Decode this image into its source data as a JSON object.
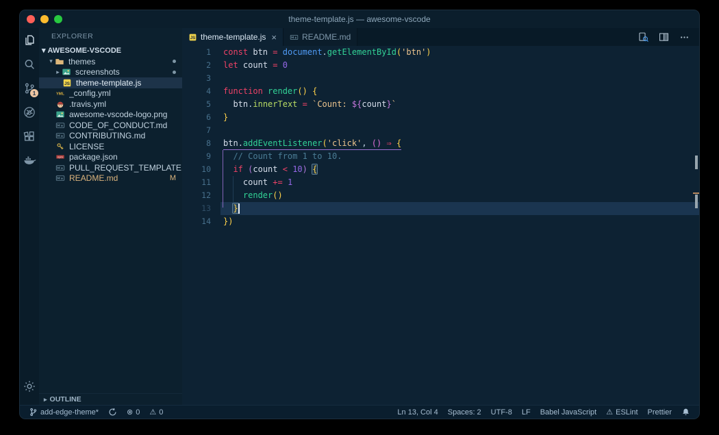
{
  "window": {
    "title": "theme-template.js — awesome-vscode",
    "traffic_lights": {
      "close": "#ff5f57",
      "minimize": "#febc2e",
      "zoom": "#28c840"
    }
  },
  "colors": {
    "pl": "#d6deeb",
    "kw": "#ee4266",
    "var": "#d6deeb",
    "fn": "#32d296",
    "blue": "#509bf5",
    "str": "#ecc48d",
    "num": "#9668e8",
    "cmt": "#4b7d96",
    "prop": "#b9dc64",
    "tpl": "#c678dd",
    "punct": "#c3d4e5",
    "p1": "#ffd24a",
    "p2": "#e06fd8",
    "p3": "#b57bdc",
    "p1m": "#ffd24a",
    "badge": "#edc5a2",
    "modified": "#dcb47d"
  },
  "activity_bar": {
    "items": [
      {
        "name": "explorer",
        "icon": "explorer",
        "active": true
      },
      {
        "name": "search",
        "icon": "search"
      },
      {
        "name": "source-control",
        "icon": "source-control",
        "badge": "1"
      },
      {
        "name": "debug-disabled",
        "icon": "bug-slash"
      },
      {
        "name": "extensions",
        "icon": "extensions"
      },
      {
        "name": "docker",
        "icon": "docker"
      }
    ],
    "bottom": [
      {
        "name": "settings",
        "icon": "gear"
      }
    ]
  },
  "sidebar": {
    "title": "EXPLORER",
    "section": "AWESOME-VSCODE",
    "outline": "OUTLINE",
    "files": [
      {
        "label": "themes",
        "icon": "folder",
        "caret": "down",
        "indent": 12,
        "dot": true
      },
      {
        "label": "screenshots",
        "icon": "image",
        "caret": "right",
        "indent": 22,
        "dot": true
      },
      {
        "label": "theme-template.js",
        "icon": "js",
        "indent": 34,
        "selected": true
      },
      {
        "label": "_config.yml",
        "icon": "yml",
        "indent": 24
      },
      {
        "label": ".travis.yml",
        "icon": "travis",
        "indent": 24
      },
      {
        "label": "awesome-vscode-logo.png",
        "icon": "image",
        "indent": 24
      },
      {
        "label": "CODE_OF_CONDUCT.md",
        "icon": "md",
        "indent": 24
      },
      {
        "label": "CONTRIBUTING.md",
        "icon": "md",
        "indent": 24
      },
      {
        "label": "LICENSE",
        "icon": "key",
        "indent": 24
      },
      {
        "label": "package.json",
        "icon": "npm",
        "indent": 24
      },
      {
        "label": "PULL_REQUEST_TEMPLATE.md",
        "icon": "md",
        "indent": 24
      },
      {
        "label": "README.md",
        "icon": "md",
        "indent": 24,
        "badge": "M",
        "modified": true
      }
    ]
  },
  "tabs": [
    {
      "name": "tab-theme-template",
      "label": "theme-template.js",
      "icon": "js",
      "active": true,
      "close": "×"
    },
    {
      "name": "tab-readme",
      "label": "README.md",
      "icon": "md"
    }
  ],
  "editor_actions": [
    {
      "name": "open-preview",
      "icon": "preview"
    },
    {
      "name": "split-editor",
      "icon": "split"
    },
    {
      "name": "more-actions",
      "icon": "ellipsis"
    }
  ],
  "editor": {
    "current_line": 13,
    "cursor": {
      "line": 13,
      "col": 3
    },
    "underline_line": 8,
    "matched_bracket_lines": [
      10,
      13
    ],
    "lines": [
      {
        "n": 1,
        "tokens": [
          [
            "const",
            "kw"
          ],
          [
            " ",
            "pl"
          ],
          [
            "btn",
            "var"
          ],
          [
            " ",
            "pl"
          ],
          [
            "=",
            "kw"
          ],
          [
            " ",
            "pl"
          ],
          [
            "document",
            "blue"
          ],
          [
            ".",
            "punct"
          ],
          [
            "getElementById",
            "fn"
          ],
          [
            "(",
            "p1"
          ],
          [
            "'btn'",
            "str"
          ],
          [
            ")",
            "p1"
          ]
        ]
      },
      {
        "n": 2,
        "tokens": [
          [
            "let",
            "kw"
          ],
          [
            " ",
            "pl"
          ],
          [
            "count",
            "var"
          ],
          [
            " ",
            "pl"
          ],
          [
            "=",
            "kw"
          ],
          [
            " ",
            "pl"
          ],
          [
            "0",
            "num"
          ]
        ]
      },
      {
        "n": 3,
        "tokens": []
      },
      {
        "n": 4,
        "tokens": [
          [
            "function",
            "kw"
          ],
          [
            " ",
            "pl"
          ],
          [
            "render",
            "fn"
          ],
          [
            "()",
            "p1"
          ],
          [
            " ",
            "pl"
          ],
          [
            "{",
            "p1"
          ]
        ]
      },
      {
        "n": 5,
        "tokens": [
          [
            "  ",
            "pl"
          ],
          [
            "btn",
            "var"
          ],
          [
            ".",
            "punct"
          ],
          [
            "innerText",
            "prop"
          ],
          [
            " ",
            "pl"
          ],
          [
            "=",
            "kw"
          ],
          [
            " ",
            "pl"
          ],
          [
            "`Count: ",
            "str"
          ],
          [
            "${",
            "tpl"
          ],
          [
            "count",
            "var"
          ],
          [
            "}",
            "tpl"
          ],
          [
            "`",
            "str"
          ]
        ]
      },
      {
        "n": 6,
        "tokens": [
          [
            "}",
            "p1"
          ]
        ]
      },
      {
        "n": 7,
        "tokens": []
      },
      {
        "n": 8,
        "tokens": [
          [
            "btn",
            "var"
          ],
          [
            ".",
            "punct"
          ],
          [
            "addEventListener",
            "fn"
          ],
          [
            "(",
            "p1"
          ],
          [
            "'click'",
            "str"
          ],
          [
            ",",
            "punct"
          ],
          [
            " ",
            "pl"
          ],
          [
            "()",
            "p2"
          ],
          [
            " ",
            "pl"
          ],
          [
            "⇒",
            "kw"
          ],
          [
            " ",
            "pl"
          ],
          [
            "{",
            "p1"
          ]
        ]
      },
      {
        "n": 9,
        "tokens": [
          [
            "  ",
            "pl"
          ],
          [
            "// Count from 1 to 10.",
            "cmt"
          ]
        ]
      },
      {
        "n": 10,
        "tokens": [
          [
            "  ",
            "pl"
          ],
          [
            "if",
            "kw"
          ],
          [
            " ",
            "pl"
          ],
          [
            "(",
            "p3"
          ],
          [
            "count",
            "var"
          ],
          [
            " ",
            "pl"
          ],
          [
            "<",
            "kw"
          ],
          [
            " ",
            "pl"
          ],
          [
            "10",
            "num"
          ],
          [
            ")",
            "p3"
          ],
          [
            " ",
            "pl"
          ],
          [
            "{",
            "p1m"
          ]
        ]
      },
      {
        "n": 11,
        "tokens": [
          [
            "    ",
            "pl"
          ],
          [
            "count",
            "var"
          ],
          [
            " ",
            "pl"
          ],
          [
            "+=",
            "kw"
          ],
          [
            " ",
            "pl"
          ],
          [
            "1",
            "num"
          ]
        ]
      },
      {
        "n": 12,
        "tokens": [
          [
            "    ",
            "pl"
          ],
          [
            "render",
            "fn"
          ],
          [
            "()",
            "p1"
          ]
        ]
      },
      {
        "n": 13,
        "tokens": [
          [
            "  ",
            "pl"
          ],
          [
            "}",
            "p1m"
          ]
        ]
      },
      {
        "n": 14,
        "tokens": [
          [
            "}",
            "p1"
          ],
          [
            ")",
            "p1"
          ]
        ]
      }
    ]
  },
  "status_bar": {
    "left": [
      {
        "name": "git-branch",
        "icon": "branch",
        "label": "add-edge-theme*"
      },
      {
        "name": "sync-changes",
        "icon": "sync",
        "label": ""
      },
      {
        "name": "errors",
        "glyph": "⊗",
        "label": "0"
      },
      {
        "name": "warnings",
        "glyph": "⚠",
        "label": "0"
      }
    ],
    "right": [
      {
        "name": "cursor-position",
        "label": "Ln 13, Col 4"
      },
      {
        "name": "indentation",
        "label": "Spaces: 2"
      },
      {
        "name": "encoding",
        "label": "UTF-8"
      },
      {
        "name": "eol",
        "label": "LF"
      },
      {
        "name": "language-mode",
        "label": "Babel JavaScript"
      },
      {
        "name": "eslint",
        "glyph": "⚠",
        "label": "ESLint"
      },
      {
        "name": "prettier",
        "label": "Prettier"
      },
      {
        "name": "notifications",
        "icon": "bell",
        "label": ""
      }
    ]
  }
}
